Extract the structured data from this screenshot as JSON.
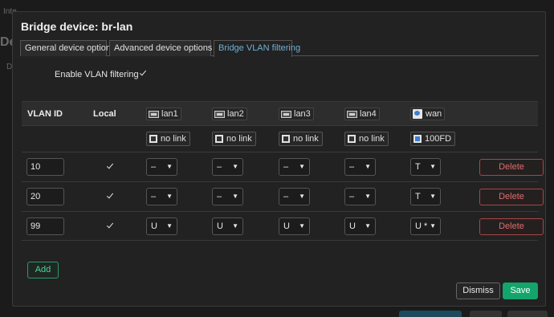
{
  "background": {
    "tab_hint": "Inte",
    "title_hint": "De",
    "sub_hint": "D"
  },
  "modal": {
    "title": "Bridge device: br-lan",
    "tabs": [
      {
        "label": "General device options",
        "active": false
      },
      {
        "label": "Advanced device options",
        "active": false
      },
      {
        "label": "Bridge VLAN filtering",
        "active": true
      }
    ],
    "enable_vlan_filtering": {
      "label": "Enable VLAN filtering",
      "checked": true
    },
    "table": {
      "headers": {
        "vlan_id": "VLAN ID",
        "local": "Local"
      },
      "ports": [
        {
          "name": "lan1",
          "icon": "ethernet-port-icon",
          "status": "no link"
        },
        {
          "name": "lan2",
          "icon": "ethernet-port-icon",
          "status": "no link"
        },
        {
          "name": "lan3",
          "icon": "ethernet-port-icon",
          "status": "no link"
        },
        {
          "name": "lan4",
          "icon": "ethernet-port-icon",
          "status": "no link"
        },
        {
          "name": "wan",
          "icon": "wan-port-icon",
          "status": "100FD"
        }
      ],
      "rows": [
        {
          "vlan_id": "10",
          "local": true,
          "ports": [
            "–",
            "–",
            "–",
            "–",
            "T"
          ],
          "wan_primary": "",
          "delete_label": "Delete"
        },
        {
          "vlan_id": "20",
          "local": true,
          "ports": [
            "–",
            "–",
            "–",
            "–",
            "T"
          ],
          "wan_primary": "",
          "delete_label": "Delete"
        },
        {
          "vlan_id": "99",
          "local": true,
          "ports": [
            "U",
            "U",
            "U",
            "U",
            "U"
          ],
          "wan_primary": "*",
          "delete_label": "Delete"
        }
      ]
    },
    "add_label": "Add",
    "dismiss_label": "Dismiss",
    "save_label": "Save"
  },
  "colors": {
    "accent": "#6fb1d6",
    "save": "#14a56d",
    "delete": "#e06b6b",
    "add": "#4cd39a"
  }
}
